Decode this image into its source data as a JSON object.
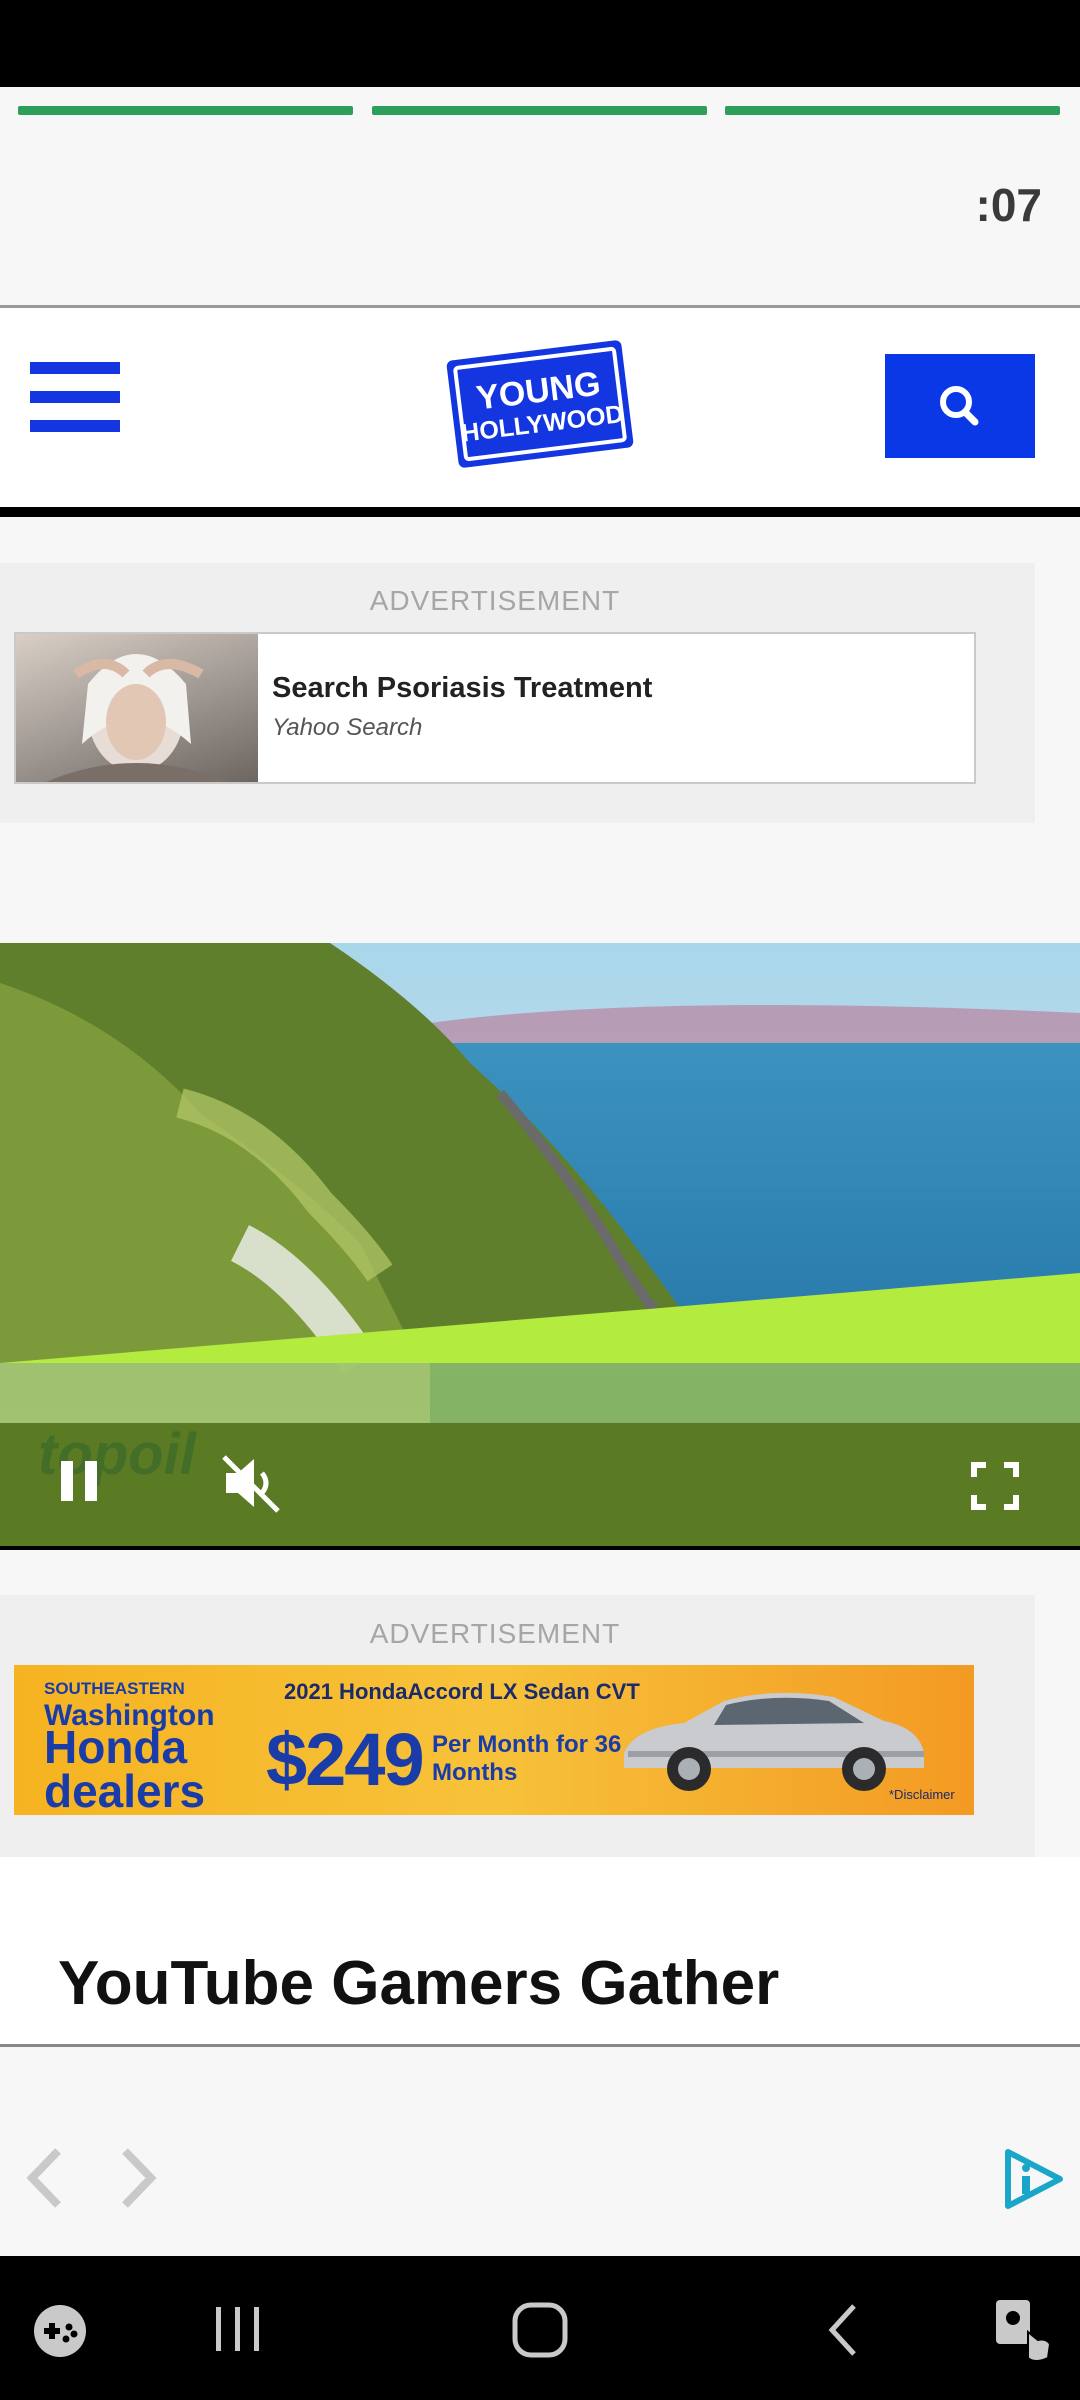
{
  "story": {
    "progress_segments": [
      1,
      1,
      1
    ],
    "timer": ":07"
  },
  "header": {
    "logo_line1": "YOUNG",
    "logo_line2": "HOLLYWOOD",
    "menu_icon": "hamburger-icon",
    "search_icon": "search-icon"
  },
  "ad1": {
    "label": "ADVERTISEMENT",
    "title": "Search Psoriasis Treatment",
    "source": "Yahoo Search"
  },
  "video": {
    "watermark": "topoil",
    "pause_icon": "pause-icon",
    "mute_icon": "muted-speaker-icon",
    "fullscreen_icon": "fullscreen-icon"
  },
  "ad2": {
    "label": "ADVERTISEMENT",
    "brand_line1": "SOUTHEASTERN",
    "brand_line2": "Washington",
    "brand_line3": "Honda dealers",
    "model": "2021 HondaAccord LX Sedan CVT",
    "price": "$249",
    "terms": "Per Month for 36 Months",
    "disclaimer": "*Disclaimer"
  },
  "article": {
    "headline": "YouTube Gamers Gather"
  },
  "story_nav": {
    "prev_icon": "chevron-left-icon",
    "next_icon": "chevron-right-icon",
    "brand_icon": "story-play-icon"
  },
  "system_nav": {
    "icons": [
      "game-launcher-icon",
      "recent-apps-icon",
      "home-icon",
      "back-icon",
      "accessibility-icon"
    ]
  },
  "colors": {
    "progress": "#2e9e5b",
    "brand_blue": "#0a38e6",
    "video_bar": "#5a7a23"
  }
}
